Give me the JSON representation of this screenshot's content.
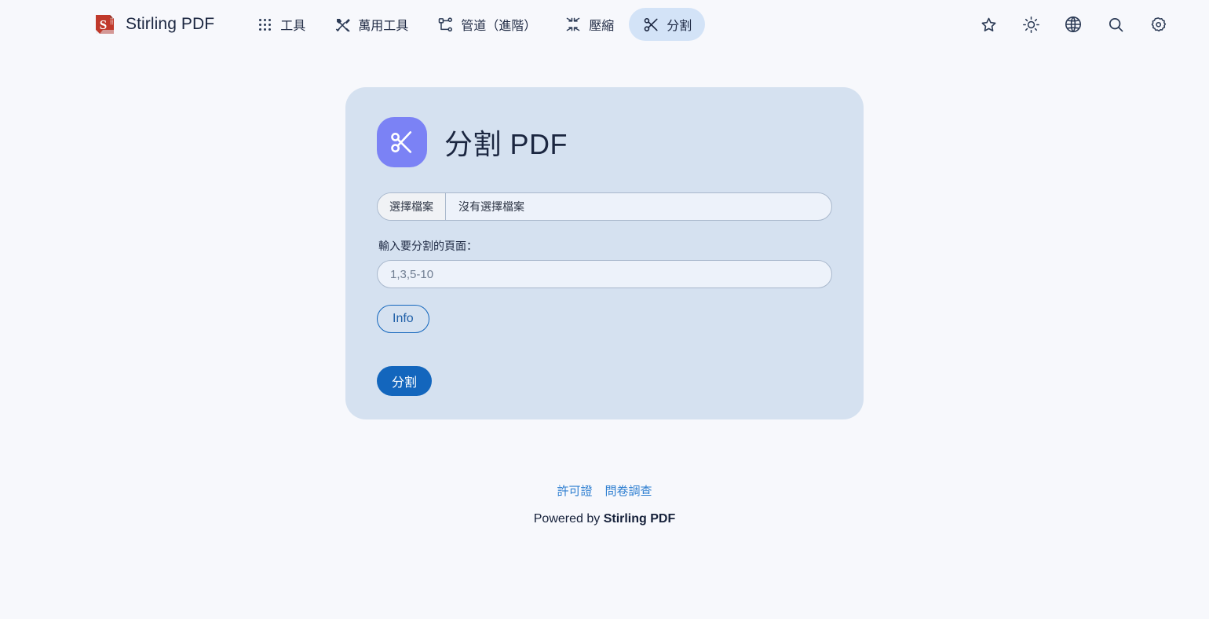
{
  "navbar": {
    "brand": {
      "name": "Stirling PDF",
      "logo_icon": "stirling-pdf-logo-icon"
    },
    "links": [
      {
        "label": "工具",
        "icon": "dot-grid-icon",
        "active": false
      },
      {
        "label": "萬用工具",
        "icon": "tools-hammer-wrench-icon",
        "active": false
      },
      {
        "label": "管道（進階）",
        "icon": "pipeline-sitemap-icon",
        "active": false
      },
      {
        "label": "壓縮",
        "icon": "compress-arrows-icon",
        "active": false
      },
      {
        "label": "分割",
        "icon": "scissors-icon",
        "active": true
      }
    ],
    "actions": [
      {
        "name": "bookmark-star-icon",
        "title": ""
      },
      {
        "name": "theme-sun-icon",
        "title": ""
      },
      {
        "name": "language-globe-icon",
        "title": ""
      },
      {
        "name": "search-icon",
        "title": ""
      },
      {
        "name": "settings-gear-icon",
        "title": ""
      }
    ]
  },
  "tool_card": {
    "icon": "scissors-icon",
    "title": "分割 PDF",
    "file_input": {
      "button_label": "選擇檔案",
      "status_text": "沒有選擇檔案"
    },
    "pages_field": {
      "label": "輸入要分割的頁面：",
      "placeholder": "1,3,5-10",
      "value": ""
    },
    "info_button": "Info",
    "submit_button": "分割"
  },
  "footer": {
    "links": [
      {
        "label": "許可證"
      },
      {
        "label": "問卷調查"
      }
    ],
    "powered_prefix": "Powered by ",
    "powered_brand": "Stirling PDF"
  },
  "colors": {
    "page_background": "#f7f8fc",
    "card_background": "#d5e1f0",
    "active_tab": "#d3e3f7",
    "tool_tile": "#7b82f5",
    "primary_button": "#1366bd",
    "link": "#2f7fd1",
    "logo_red": "#c0392b"
  }
}
